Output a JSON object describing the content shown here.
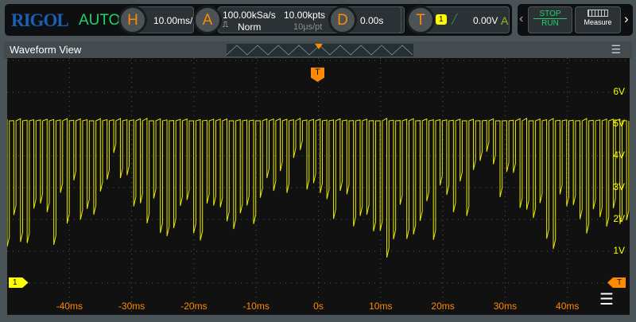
{
  "header": {
    "logo": "RIGOL",
    "mode": "AUTO",
    "horizontal": {
      "badge": "H",
      "timebase": "10.00ms/"
    },
    "acquire": {
      "badge": "A",
      "sample_rate": "100.00kSa/s",
      "memory_depth": "10.00kpts",
      "acq_mode": "Norm",
      "sample_interval": "10μs/pt"
    },
    "delay": {
      "badge": "D",
      "value": "0.00s"
    },
    "trigger": {
      "badge": "T",
      "source": "1",
      "level": "0.00V",
      "sweep": "A"
    },
    "stop_label": "STOP",
    "run_label": "RUN",
    "measure_label": "Measure"
  },
  "view": {
    "title": "Waveform View"
  },
  "y_labels": [
    "6V",
    "5V",
    "4V",
    "3V",
    "2V",
    "1V"
  ],
  "x_labels": [
    "-40ms",
    "-30ms",
    "-20ms",
    "-10ms",
    "0s",
    "10ms",
    "20ms",
    "30ms",
    "40ms"
  ],
  "channel": {
    "label": "1",
    "color": "#ffff00"
  },
  "trigger_marker": "T",
  "colors": {
    "accent": "#ff8a00",
    "run": "#1fd36a",
    "trace": "#ffff00",
    "axis_text": "#ff8a00"
  }
}
